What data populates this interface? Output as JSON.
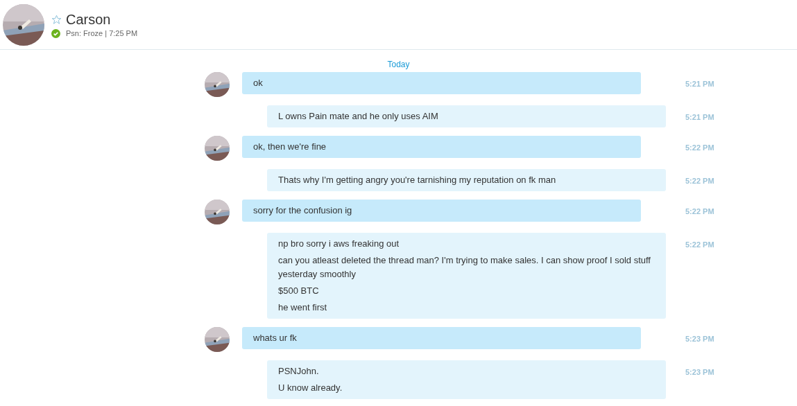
{
  "header": {
    "name": "Carson",
    "status": "Psn: Froze | 7:25 PM"
  },
  "date_divider": "Today",
  "messages": [
    {
      "kind": "incoming",
      "lines": [
        "ok"
      ],
      "time": "5:21 PM"
    },
    {
      "kind": "outgoing",
      "lines": [
        "L owns Pain mate and he only uses AIM"
      ],
      "time": "5:21 PM"
    },
    {
      "kind": "incoming",
      "lines": [
        "ok, then we're fine"
      ],
      "time": "5:22 PM"
    },
    {
      "kind": "outgoing",
      "lines": [
        "Thats why I'm getting angry you're tarnishing my reputation on fk man"
      ],
      "time": "5:22 PM"
    },
    {
      "kind": "incoming",
      "lines": [
        "sorry for the confusion ig"
      ],
      "time": "5:22 PM"
    },
    {
      "kind": "outgoing",
      "lines": [
        "np bro sorry i aws freaking out",
        "can you atleast deleted the thread man? I'm trying to make sales. I can show proof I sold stuff yesterday smoothly",
        "$500 BTC",
        "he went first"
      ],
      "time": "5:22 PM"
    },
    {
      "kind": "incoming",
      "lines": [
        "whats ur fk"
      ],
      "time": "5:23 PM"
    },
    {
      "kind": "outgoing",
      "lines": [
        "PSNJohn.",
        "U know already."
      ],
      "time": "5:23 PM"
    }
  ]
}
